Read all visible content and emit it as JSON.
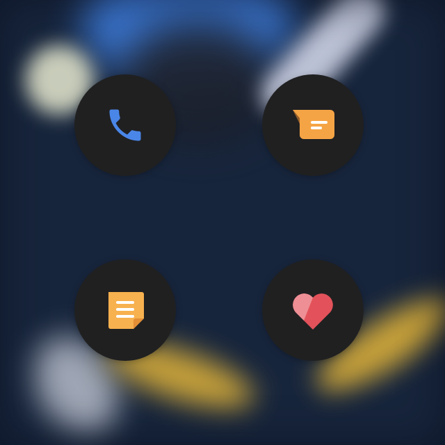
{
  "screen": {
    "type": "watch-app-launcher",
    "background_color": "#17253c"
  },
  "apps": [
    {
      "id": "phone",
      "icon": "phone-icon",
      "accent": "#4a86e8"
    },
    {
      "id": "messages",
      "icon": "message-bubble-icon",
      "accent": "#f5a445"
    },
    {
      "id": "notes",
      "icon": "note-icon",
      "accent": "#f7b14f"
    },
    {
      "id": "health",
      "icon": "heart-icon",
      "accent": "#e3525a"
    }
  ],
  "colors": {
    "icon_background": "#202021",
    "wallpaper_blue": "#3f7fe0",
    "wallpaper_yellow": "#e3b53a"
  }
}
